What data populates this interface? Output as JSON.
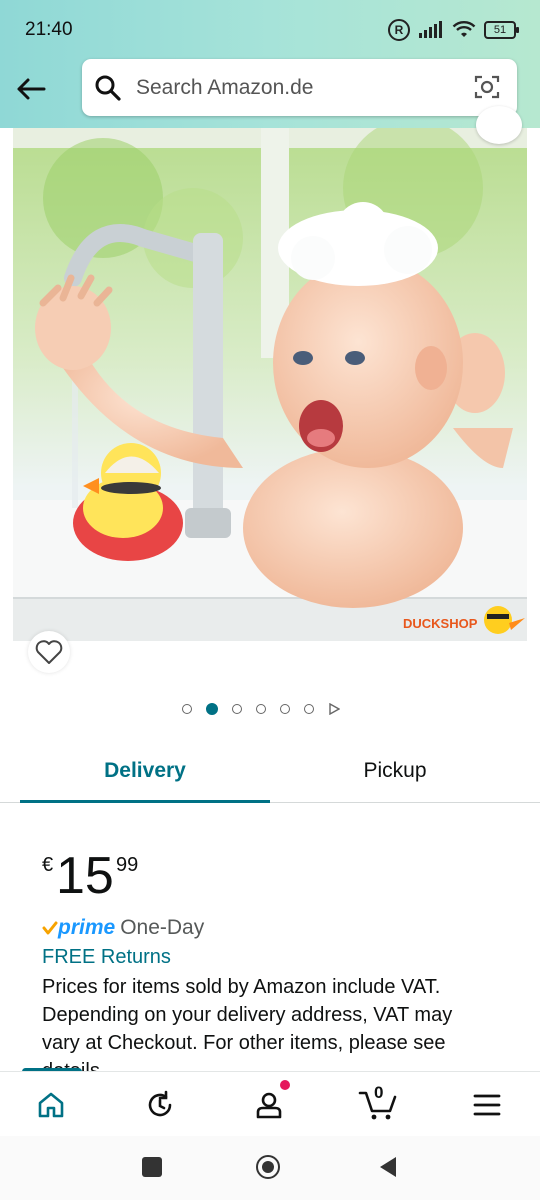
{
  "status_bar": {
    "time": "21:40",
    "battery": "51"
  },
  "search": {
    "placeholder": "Search Amazon.de"
  },
  "product_image": {
    "watermark": "DUCKSHOP"
  },
  "carousel": {
    "dots": 6,
    "active_index": 1
  },
  "tabs": {
    "delivery": "Delivery",
    "pickup": "Pickup"
  },
  "price": {
    "currency": "€",
    "whole": "15",
    "fraction": "99"
  },
  "delivery": {
    "prime_label": "prime",
    "prime_speed": "One-Day",
    "free_returns": "FREE Returns",
    "vat_notice": "Prices for items sold by Amazon include VAT. Depending on your delivery address, VAT may vary at Checkout. For other items, please see details."
  },
  "bottom_nav": {
    "cart_count": "0"
  },
  "colors": {
    "accent": "#007185",
    "prime_blue": "#1a98ff",
    "header_start": "#8fd8d6",
    "header_end": "#b6e8d0",
    "notification": "#e5175c"
  }
}
